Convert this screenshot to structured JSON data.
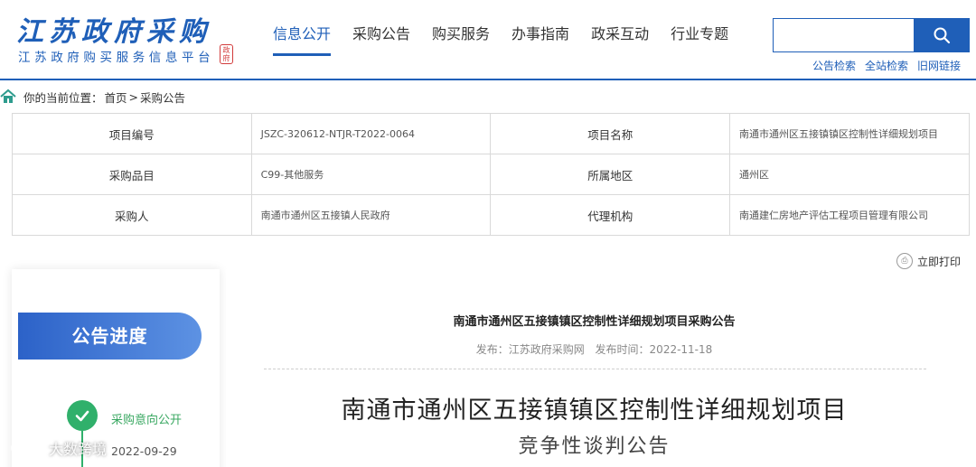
{
  "header": {
    "logo_title": "江苏政府采购",
    "logo_subtitle": "江苏政府购买服务信息平台",
    "logo_seal": "政府",
    "nav": [
      {
        "label": "信息公开",
        "active": true
      },
      {
        "label": "采购公告",
        "active": false
      },
      {
        "label": "购买服务",
        "active": false
      },
      {
        "label": "办事指南",
        "active": false
      },
      {
        "label": "政采互动",
        "active": false
      },
      {
        "label": "行业专题",
        "active": false
      }
    ],
    "search_value": "",
    "quick_links": [
      "公告检索",
      "全站检索",
      "旧网链接"
    ],
    "accent_color": "#1f5fb8"
  },
  "breadcrumb": {
    "prefix": "你的当前位置：",
    "home": "首页",
    "separator": " > ",
    "current": "采购公告"
  },
  "info_table": {
    "rows": [
      {
        "l1": "项目编号",
        "v1": "JSZC-320612-NTJR-T2022-0064",
        "l2": "项目名称",
        "v2": "南通市通州区五接镇镇区控制性详细规划项目"
      },
      {
        "l1": "采购品目",
        "v1": "C99-其他服务",
        "l2": "所属地区",
        "v2": "通州区"
      },
      {
        "l1": "采购人",
        "v1": "南通市通州区五接镇人民政府",
        "l2": "代理机构",
        "v2": "南通建仁房地产评估工程项目管理有限公司"
      }
    ]
  },
  "print_label": "立即打印",
  "progress": {
    "title": "公告进度",
    "step_label": "采购意向公开",
    "step_date": "2022-09-29",
    "step_color": "#30b06b"
  },
  "document": {
    "title": "南通市通州区五接镇镇区控制性详细规划项目采购公告",
    "publisher": "发布：江苏政府采购网",
    "publish_time": "发布时间：2022-11-18",
    "big_title": "南通市通州区五接镇镇区控制性详细规划项目",
    "sub_title": "竞争性谈判公告"
  },
  "watermark": "大数跨境"
}
